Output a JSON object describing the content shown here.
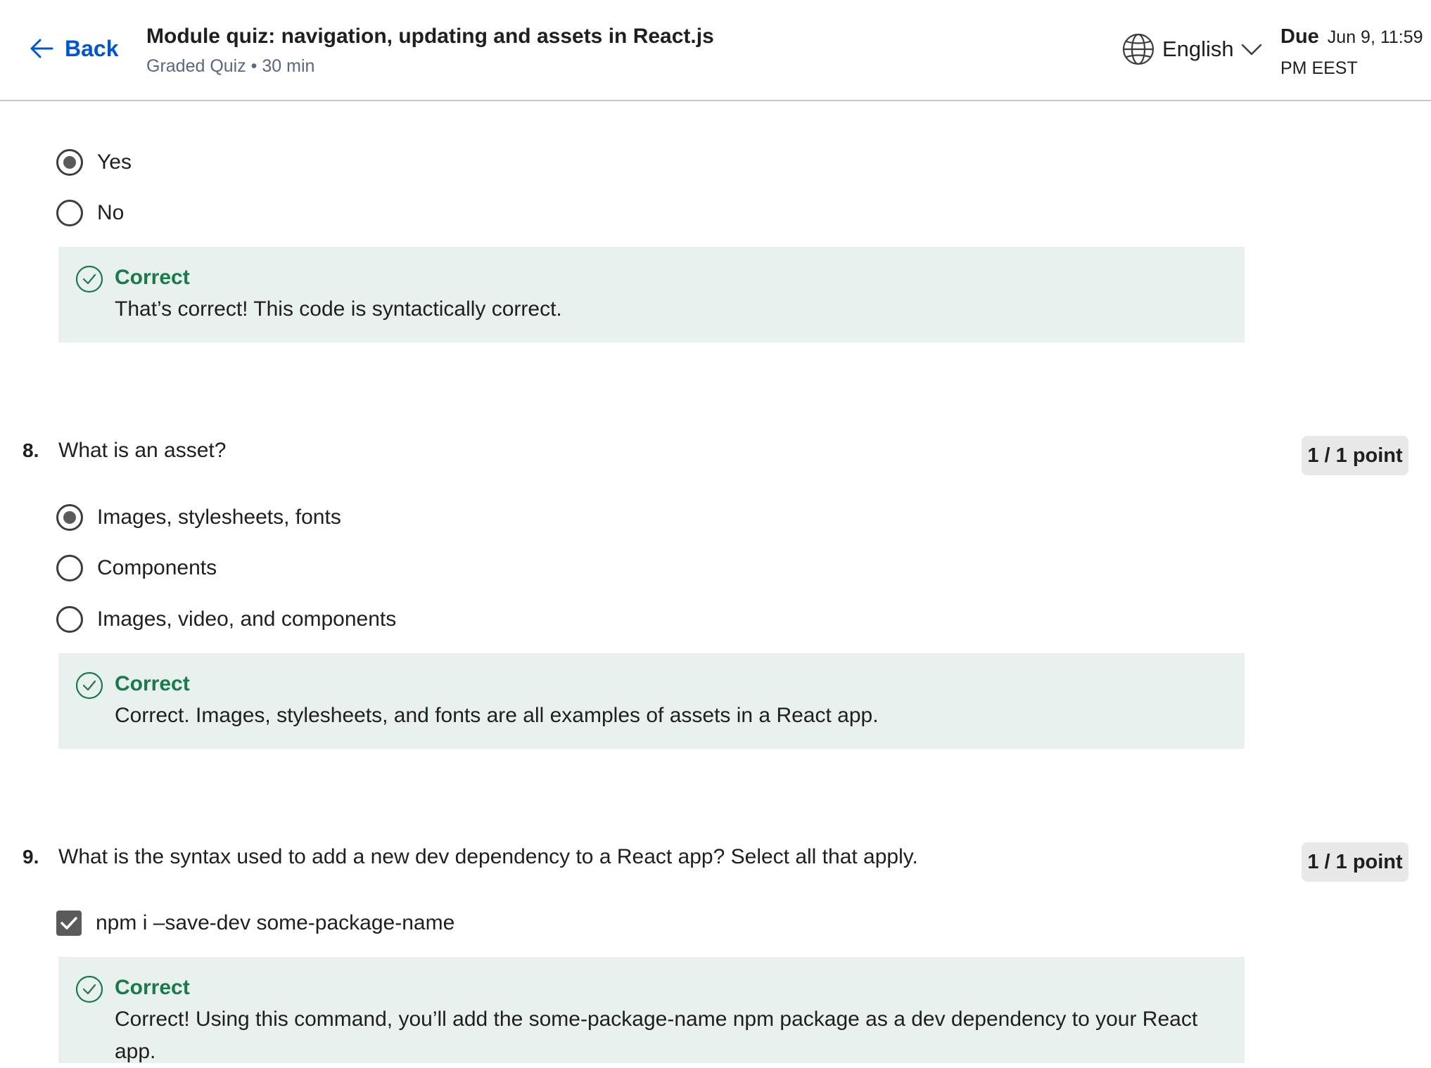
{
  "header": {
    "back_label": "Back",
    "title": "Module quiz: navigation, updating and assets in React.js",
    "subtitle": "Graded Quiz • 30 min",
    "language": "English",
    "due_label": "Due",
    "due_date_line1": "Jun 9, 11:59",
    "due_date_line2": "PM EEST"
  },
  "q7": {
    "options": [
      {
        "label": "Yes",
        "selected": true
      },
      {
        "label": "No",
        "selected": false
      }
    ],
    "feedback": {
      "title": "Correct",
      "text": "That’s correct! This code is syntactically correct."
    }
  },
  "q8": {
    "number": "8.",
    "question": "What is an asset?",
    "points": "1 / 1 point",
    "options": [
      {
        "label": "Images, stylesheets, fonts",
        "selected": true
      },
      {
        "label": "Components",
        "selected": false
      },
      {
        "label": "Images, video, and components",
        "selected": false
      }
    ],
    "feedback": {
      "title": "Correct",
      "text": "Correct. Images, stylesheets, and fonts are all examples of assets in a React app."
    }
  },
  "q9": {
    "number": "9.",
    "question": "What is the syntax used to add a new dev dependency to a React app? Select all that apply.",
    "points": "1 / 1 point",
    "options": [
      {
        "label": "npm i –save-dev some-package-name",
        "checked": true
      }
    ],
    "feedback": {
      "title": "Correct",
      "text": "Correct! Using this command, you’ll add the some-package-name npm package as a dev dependency to your React app."
    }
  },
  "colors": {
    "link": "#0056d2",
    "correct_green": "#197a4c",
    "feedback_bg": "#e8f1ee",
    "points_bg": "#e8e8e8"
  }
}
